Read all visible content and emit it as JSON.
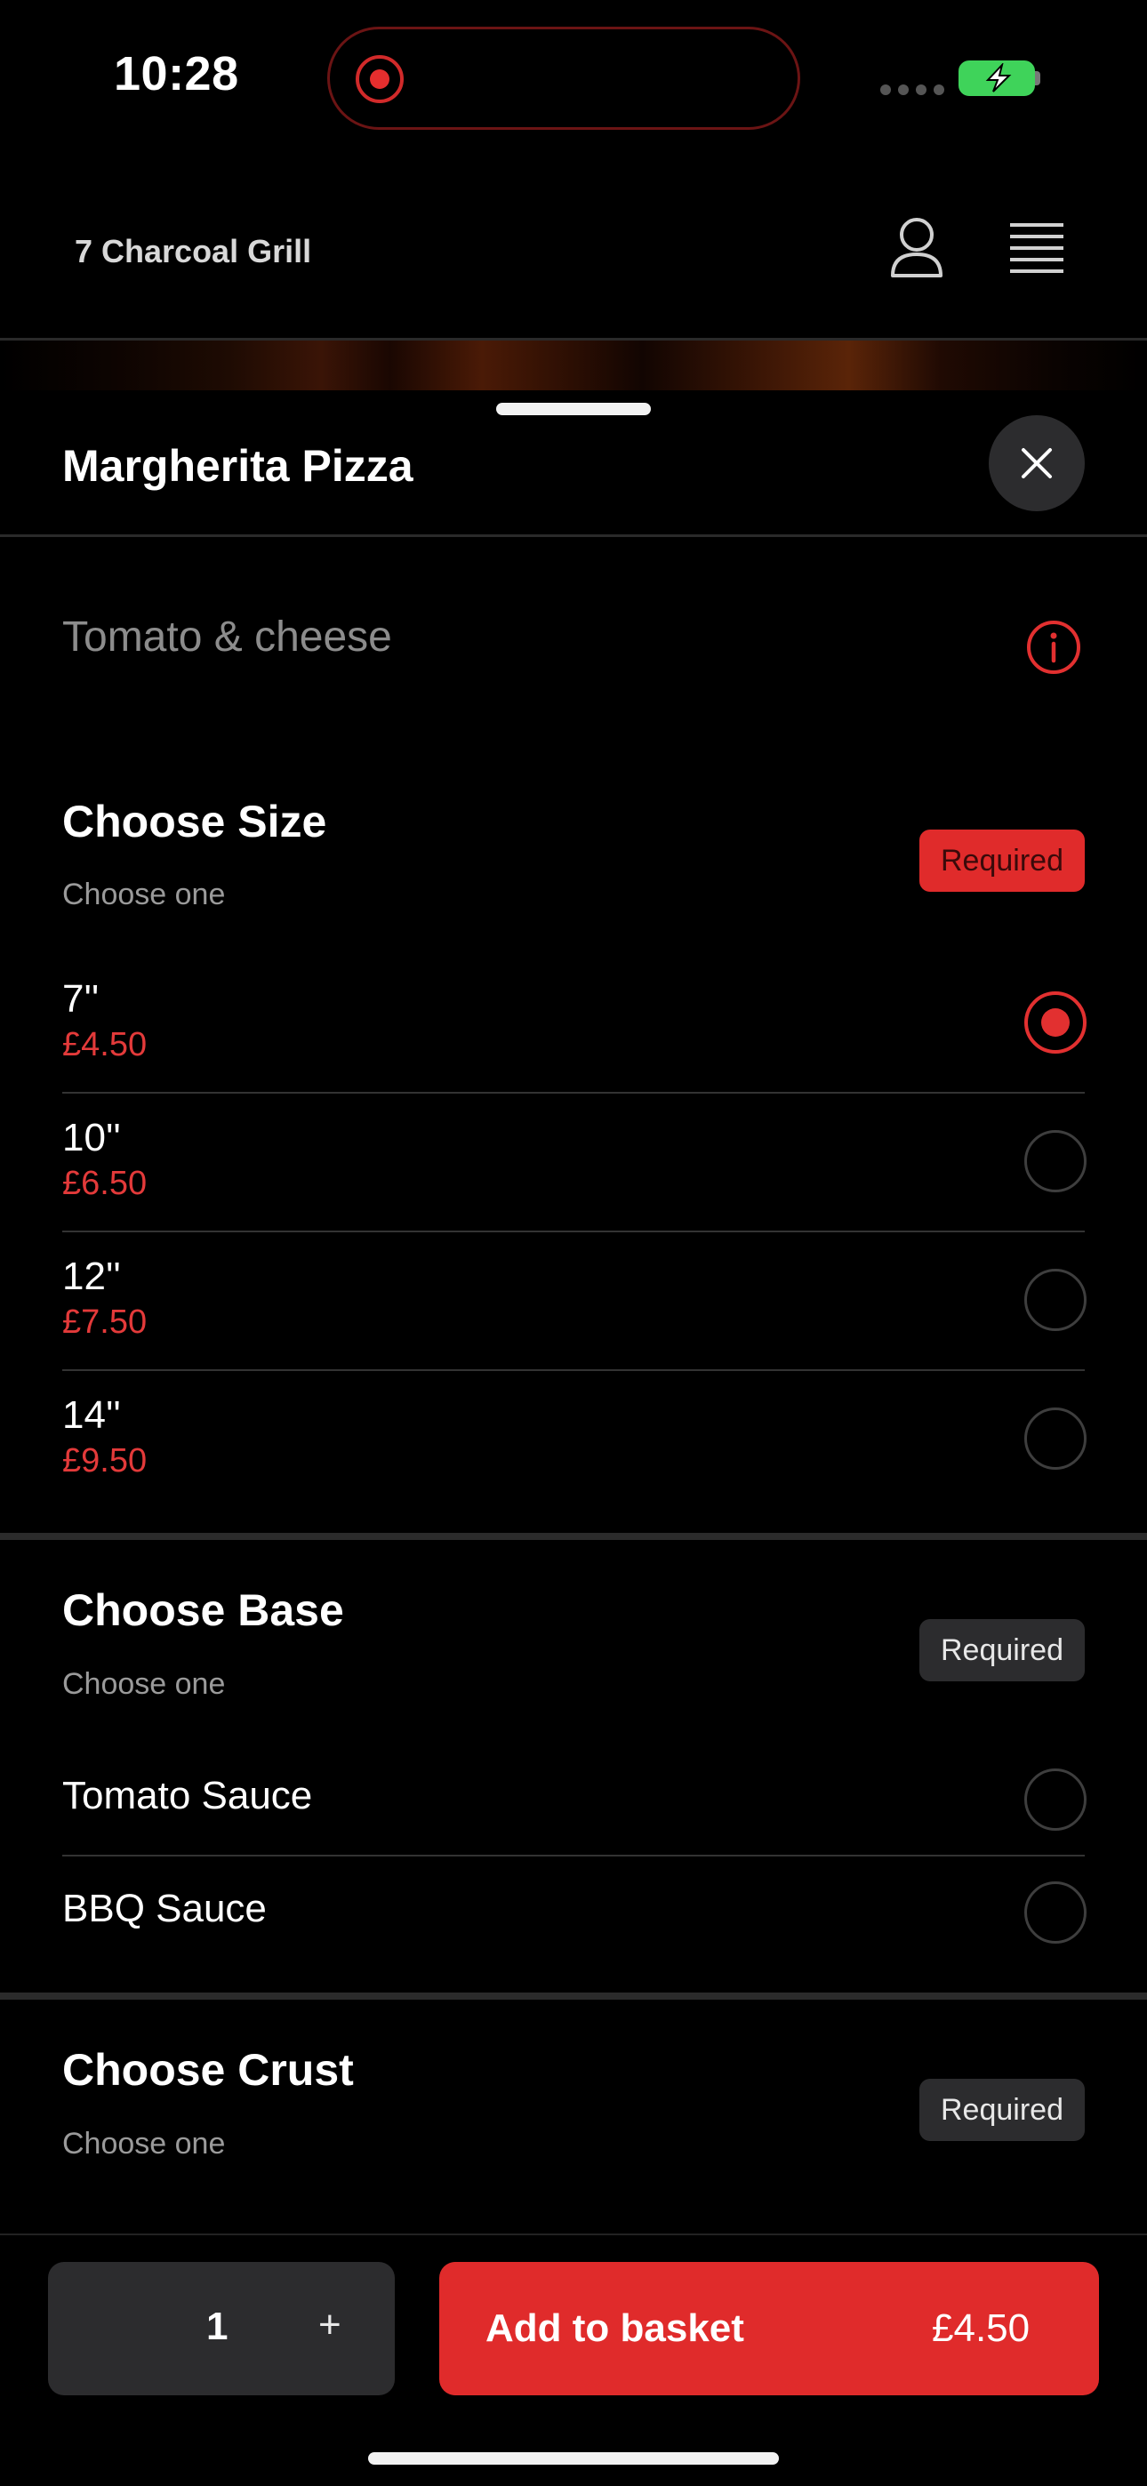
{
  "status": {
    "time": "10:28"
  },
  "header": {
    "brand": "7 Charcoal Grill"
  },
  "item": {
    "title": "Margherita Pizza",
    "description": "Tomato & cheese"
  },
  "sections": {
    "size": {
      "title": "Choose Size",
      "subtitle": "Choose one",
      "badge": "Required",
      "options": [
        {
          "name": "7''",
          "price": "£4.50",
          "selected": true
        },
        {
          "name": "10''",
          "price": "£6.50",
          "selected": false
        },
        {
          "name": "12''",
          "price": "£7.50",
          "selected": false
        },
        {
          "name": "14''",
          "price": "£9.50",
          "selected": false
        }
      ]
    },
    "base": {
      "title": "Choose Base",
      "subtitle": "Choose one",
      "badge": "Required",
      "options": [
        {
          "name": "Tomato Sauce",
          "selected": false
        },
        {
          "name": "BBQ Sauce",
          "selected": false
        }
      ]
    },
    "crust": {
      "title": "Choose Crust",
      "subtitle": "Choose one",
      "badge": "Required"
    }
  },
  "footer": {
    "quantity": "1",
    "plus": "+",
    "add_label": "Add to basket",
    "add_price": "£4.50"
  },
  "colors": {
    "accent": "#e02b2b",
    "background": "#000000",
    "surface": "#2c2c2e"
  }
}
